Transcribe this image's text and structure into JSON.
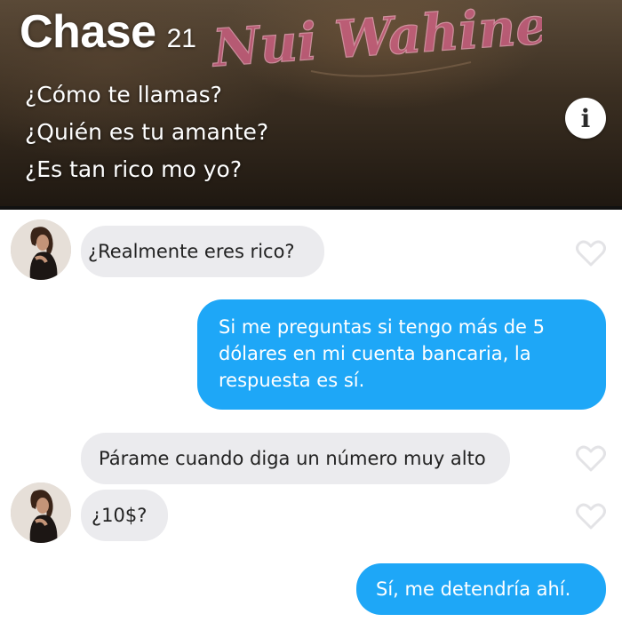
{
  "profile": {
    "name": "Chase",
    "age": "21",
    "bio": [
      "¿Cómo te llamas?",
      "¿Quién es tu amante?",
      "¿Es tan rico mo yo?"
    ],
    "info_glyph": "i",
    "tattoo_text": "Nui Wahine",
    "info_icon": "info-icon"
  },
  "messages": [
    {
      "direction": "received",
      "text": "¿Realmente eres rico?"
    },
    {
      "direction": "sent",
      "text": "Si me preguntas si tengo más de 5 dólares en mi cuenta bancaria, la respuesta es sí."
    },
    {
      "direction": "received",
      "text": "Párame cuando diga un número muy alto"
    },
    {
      "direction": "received",
      "text": "¿10$?"
    },
    {
      "direction": "sent",
      "text": "Sí, me detendría ahí."
    }
  ],
  "colors": {
    "sent_bubble": "#1ea7f7",
    "received_bubble": "#ebebee",
    "like_icon": "#e3e3e6"
  }
}
